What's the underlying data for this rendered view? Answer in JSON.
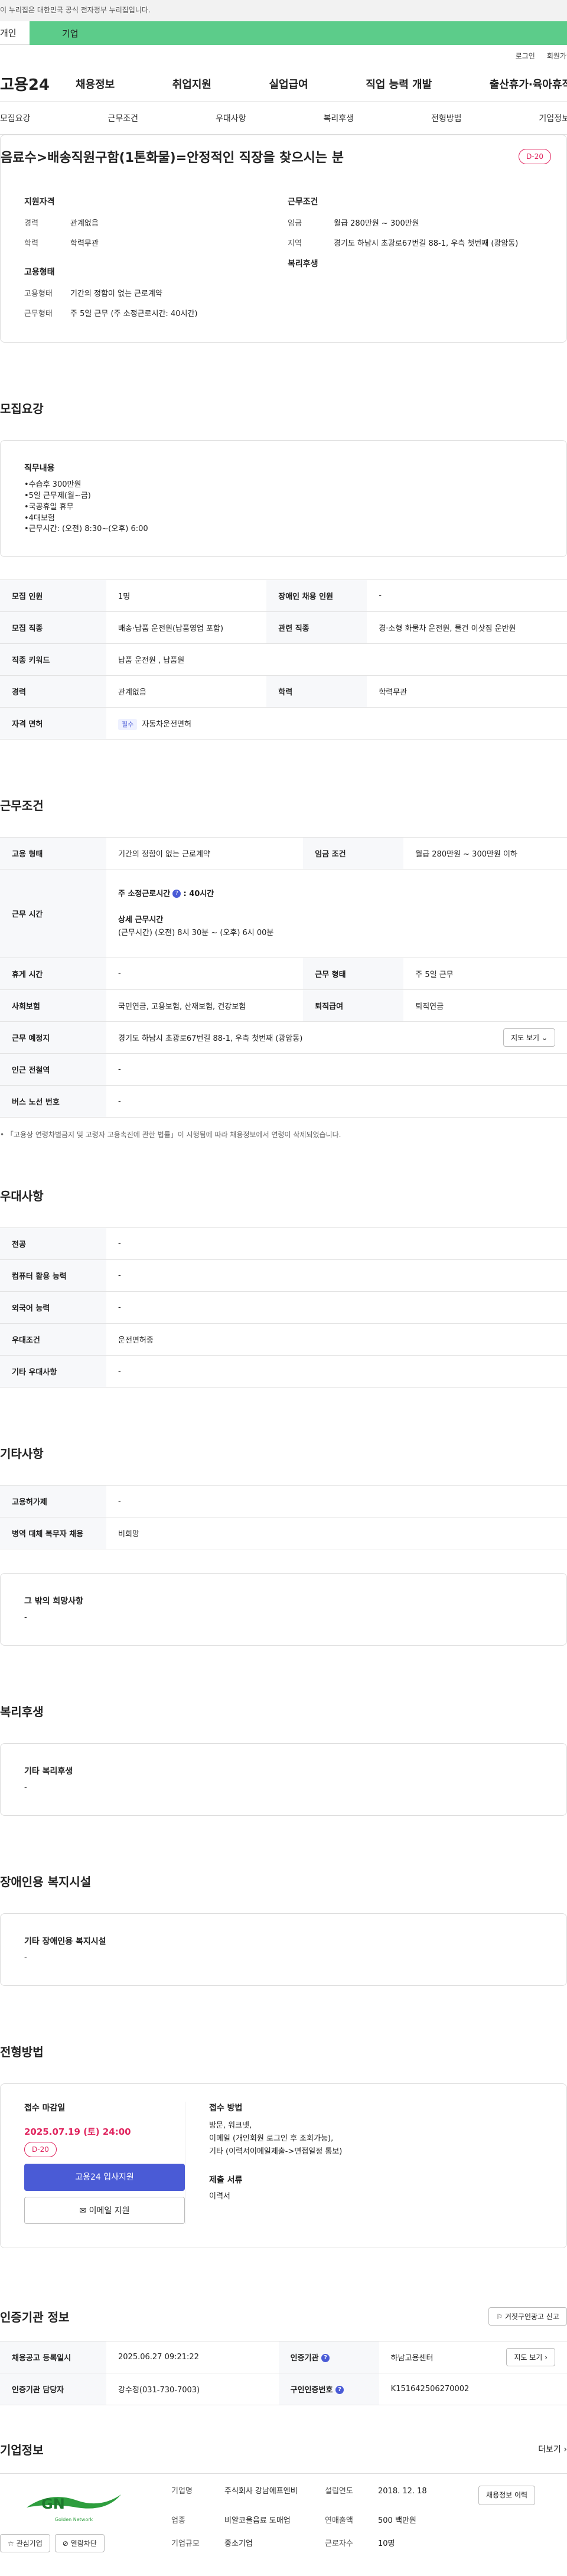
{
  "gov_notice": "이 누리집은 대한민국 공식 전자정부 누리집입니다.",
  "tabs": {
    "person": "개인",
    "biz": "기업"
  },
  "util": {
    "login": "로그인",
    "signup": "회원가입"
  },
  "logo": "고용24",
  "gnb": [
    "채용정보",
    "취업지원",
    "실업급여",
    "직업 능력 개발",
    "출산휴가·육아휴직"
  ],
  "subnav": [
    "모집요강",
    "근무조건",
    "우대사항",
    "복리후생",
    "전형방법",
    "기업정보"
  ],
  "summary": {
    "title": "음료수>배송직원구함(1톤화물)=안정적인 직장을 찾으시는 분",
    "dday": "D-20",
    "qual_h": "지원자격",
    "qual": [
      {
        "k": "경력",
        "v": "관계없음"
      },
      {
        "k": "학력",
        "v": "학력무관"
      }
    ],
    "work_h": "근무조건",
    "work": [
      {
        "k": "임금",
        "v": "월급 280만원 ~ 300만원"
      },
      {
        "k": "지역",
        "v": "경기도 하남시 초광로67번길 88-1, 우측 첫번째 (광암동)"
      }
    ],
    "emp_h": "고용형태",
    "emp": [
      {
        "k": "고용형태",
        "v": "기간의 정함이 없는 근로계약"
      },
      {
        "k": "근무형태",
        "v": "주 5일 근무 (주 소정근로시간: 40시간)"
      }
    ],
    "welfare_h": "복리후생"
  },
  "recruit": {
    "title": "모집요강",
    "duty_h": "직무내용",
    "duty": "•수습후 300만원\n•5일 근무제(월~금)\n•국공휴일 휴무\n•4대보험\n•근무시간: (오전) 8:30~(오후) 6:00",
    "rows": [
      {
        "k1": "모집 인원",
        "v1": "1명",
        "k2": "장애인 채용 인원",
        "v2": "-"
      },
      {
        "k1": "모집 직종",
        "v1": "배송·납품 운전원(납품영업 포함)",
        "k2": "관련 직종",
        "v2": "경·소형 화물차 운전원, 물건 이삿짐 운반원"
      },
      {
        "k1": "직종 키워드",
        "v1": "납품 운전원 , 납품원",
        "k2": "",
        "v2": ""
      },
      {
        "k1": "경력",
        "v1": "관계없음",
        "k2": "학력",
        "v2": "학력무관"
      }
    ],
    "license_k": "자격 면허",
    "license_tag": "필수",
    "license_v": "자동차운전면허"
  },
  "work": {
    "title": "근무조건",
    "emp_k": "고용 형태",
    "emp_v": "기간의 정함이 없는 근로계약",
    "wage_k": "임금 조건",
    "wage_v": "월급 280만원 ~ 300만원 이하",
    "time_k": "근무 시간",
    "time_main": "주 소정근로시간",
    "time_hours": ": 40시간",
    "time_detail_h": "상세 근무시간",
    "time_detail": "(근무시간) (오전) 8시 30분 ~ (오후) 6시 00분",
    "rest_k": "휴게 시간",
    "rest_v": "-",
    "shift_k": "근무 형태",
    "shift_v": "주 5일 근무",
    "ins_k": "사회보험",
    "ins_v": "국민연금, 고용보험, 산재보험, 건강보험",
    "ret_k": "퇴직급여",
    "ret_v": "퇴직연금",
    "place_k": "근무 예정지",
    "place_v": "경기도 하남시 초광로67번길 88-1, 우측 첫번째 (광암동)",
    "map_btn": "지도 보기",
    "subway_k": "인근 전철역",
    "subway_v": "-",
    "bus_k": "버스 노선 번호",
    "bus_v": "-",
    "note": "「고용상 연령차별금지 및 고령자 고용촉진에 관한 법률」이 시행됨에 따라 채용정보에서 연령이 삭제되었습니다."
  },
  "pref": {
    "title": "우대사항",
    "rows": [
      {
        "k": "전공",
        "v": "-"
      },
      {
        "k": "컴퓨터 활용 능력",
        "v": "-"
      },
      {
        "k": "외국어 능력",
        "v": "-"
      },
      {
        "k": "우대조건",
        "v": "운전면허증"
      },
      {
        "k": "기타 우대사항",
        "v": "-"
      }
    ]
  },
  "etc": {
    "title": "기타사항",
    "rows": [
      {
        "k": "고용허가제",
        "v": "-"
      },
      {
        "k": "병역 대체 복무자 채용",
        "v": "비희망"
      }
    ],
    "other_h": "그 밖의 희망사항",
    "other_v": "-"
  },
  "welfare": {
    "title": "복리후생",
    "h": "기타 복리후생",
    "v": "-"
  },
  "disabled": {
    "title": "장애인용 복지시설",
    "h": "기타 장애인용 복지시설",
    "v": "-"
  },
  "process": {
    "title": "전형방법",
    "deadline_h": "접수 마감일",
    "deadline": "2025.07.19 (토) 24:00",
    "dday": "D-20",
    "apply_btn": "고용24 입사지원",
    "email_btn": "이메일 지원",
    "method_h": "접수 방법",
    "method": "방문, 워크넷,\n이메일 (개인회원 로그인 후 조회가능),\n기타 (이력서이메일제출->면접일정 통보)",
    "docs_h": "제출 서류",
    "docs": "이력서"
  },
  "cert": {
    "title": "인증기관 정보",
    "report_btn": "거짓구인광고 신고",
    "date_k": "채용공고 등록일시",
    "date_v": "2025.06.27 09:21:22",
    "org_k": "인증기관",
    "org_v": "하남고용센터",
    "map_btn": "지도 보기",
    "staff_k": "인증기관 담당자",
    "staff_v": "강수정(031-730-7003)",
    "id_k": "구인인증번호",
    "id_v": "K151642506270002"
  },
  "company": {
    "title": "기업정보",
    "more": "더보기",
    "logo_text": "Golden Network",
    "fav_btn": "관심기업",
    "like_btn": "열람차단",
    "name_k": "기업명",
    "name_v": "주식회사 강남에프엔비",
    "biz_k": "업종",
    "biz_v": "비알코올음료 도매업",
    "size_k": "기업규모",
    "size_v": "중소기업",
    "est_k": "설립연도",
    "est_v": "2018. 12. 18",
    "sales_k": "연매출액",
    "sales_v": "500 백만원",
    "emp_k": "근로자수",
    "emp_v": "10명",
    "jobs_btn": "채용정보 이력"
  }
}
